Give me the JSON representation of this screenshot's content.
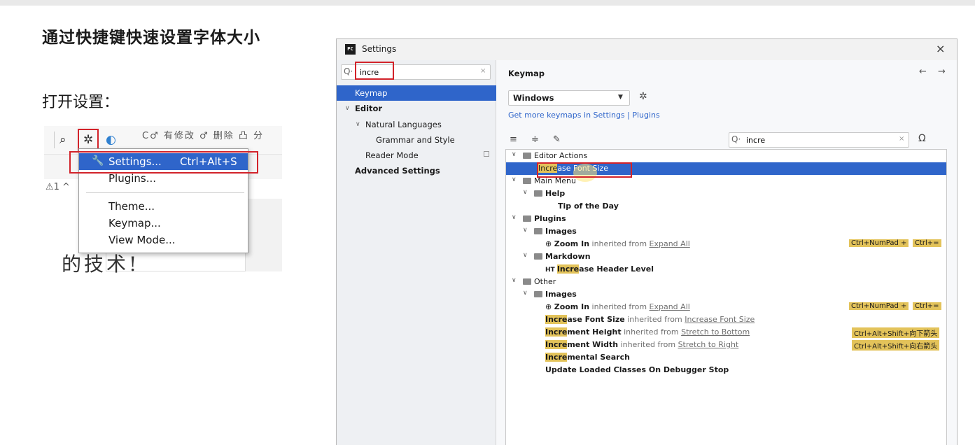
{
  "slide": {
    "title": "通过快捷键快速设置字体大小",
    "step_label": "打开设置："
  },
  "mini": {
    "toolbar_cut": "C♂ 有修改  ♂ 删除  凸 分",
    "warning": "⚠1 ^",
    "editor_big": "的技术!",
    "menu": [
      {
        "label": "Settings...",
        "shortcut": "Ctrl+Alt+S",
        "selected": true
      },
      {
        "label": "Plugins...",
        "shortcut": ""
      },
      {
        "label": "Theme...",
        "shortcut": ""
      },
      {
        "label": "Keymap...",
        "shortcut": ""
      },
      {
        "label": "View Mode...",
        "shortcut": ""
      }
    ]
  },
  "dialog": {
    "title": "Settings",
    "logo": "PC",
    "close": "×",
    "left_search": {
      "value": "incre",
      "clear": "×"
    },
    "tree": [
      {
        "label": "Keymap",
        "selected": true
      },
      {
        "label": "Editor",
        "toggle": "∨"
      },
      {
        "label": "Natural Languages",
        "toggle": "∨"
      },
      {
        "label": "Grammar and Style"
      },
      {
        "label": "Reader Mode"
      },
      {
        "label": "Advanced Settings"
      }
    ],
    "right": {
      "header": "Keymap",
      "nav": "← →",
      "keymap_select": "Windows",
      "link": "Get more keymaps in Settings | Plugins",
      "tools": "≡ ≑ ✎",
      "search_value": "incre",
      "search_clear": "×",
      "rows": {
        "r0": "Editor Actions",
        "r1a": "Incre",
        "r1b": "ase Font Size",
        "r2": "Main Menu",
        "r3": "Help",
        "r4": "Tip of the Day",
        "r5": "Plugins",
        "r6": "Images",
        "r7a": "Zoom In",
        "r7b": " inherited from ",
        "r7c": "Expand All",
        "r7s1": "Ctrl+NumPad +",
        "r7s2": "Ctrl+=",
        "r8": "Markdown",
        "r9pre": "HT ",
        "r9a": "Incre",
        "r9b": "ase Header Level",
        "r10": "Other",
        "r11": "Images",
        "r12a": "Zoom In",
        "r12b": " inherited from ",
        "r12c": "Expand All",
        "r12s1": "Ctrl+NumPad +",
        "r12s2": "Ctrl+=",
        "r13a": "Incre",
        "r13b": "ase Font Size",
        "r13c": " inherited from ",
        "r13d": "Increase Font Size",
        "r14a": "Incre",
        "r14b": "ment Height",
        "r14c": " inherited from ",
        "r14d": "Stretch to Bottom",
        "r14s": "Ctrl+Alt+Shift+向下箭头",
        "r15a": "Incre",
        "r15b": "ment Width",
        "r15c": " inherited from ",
        "r15d": "Stretch to Right",
        "r15s": "Ctrl+Alt+Shift+向右箭头",
        "r16a": "Incre",
        "r16b": "mental Search",
        "r17": "Update Loaded Classes On Debugger Stop"
      }
    }
  },
  "colors": {
    "accent": "#2f65ca",
    "highlight": "#e3c35a",
    "annotation": "#d2232a"
  }
}
